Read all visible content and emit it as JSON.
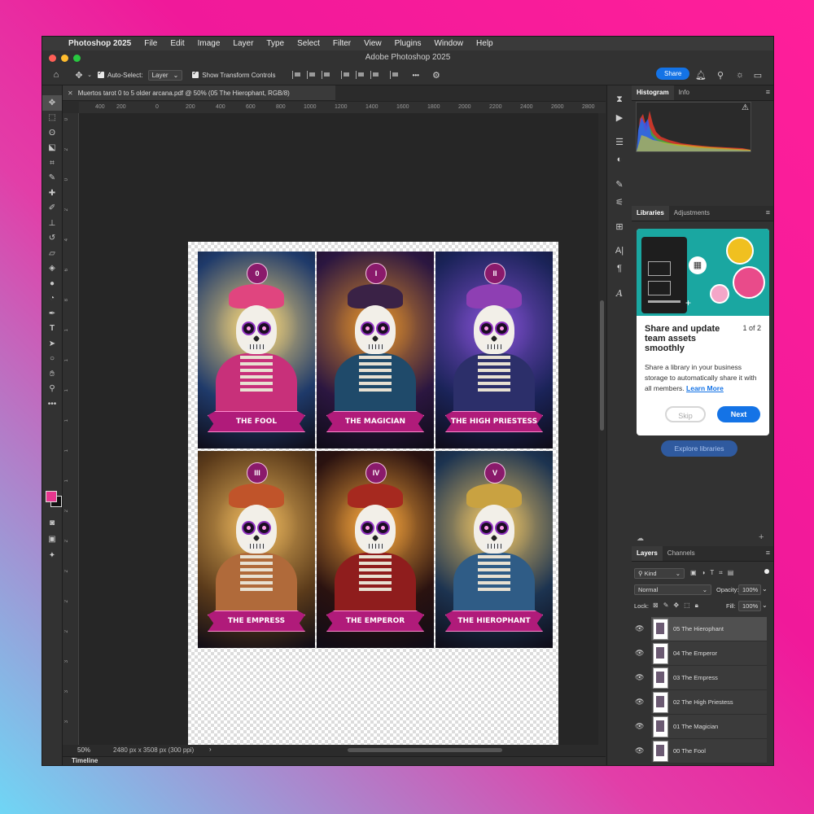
{
  "menubar": {
    "app_name": "Photoshop 2025",
    "items": [
      "File",
      "Edit",
      "Image",
      "Layer",
      "Type",
      "Select",
      "Filter",
      "View",
      "Plugins",
      "Window",
      "Help"
    ]
  },
  "window": {
    "title": "Adobe Photoshop 2025"
  },
  "options_bar": {
    "auto_select_label": "Auto-Select:",
    "auto_select_value": "Layer",
    "show_transform_label": "Show Transform Controls",
    "more": "•••",
    "share_label": "Share"
  },
  "document": {
    "tab_title": "Muertos tarot  0 to 5 older arcana.pdf @ 50% (05 The Hierophant, RGB/8)",
    "zoom": "50%",
    "dimensions": "2480 px x 3508 px (300 ppi)",
    "hruler_labels": [
      "400",
      "200",
      "0",
      "200",
      "400",
      "600",
      "800",
      "1000",
      "1200",
      "1400",
      "1600",
      "1800",
      "2000",
      "2200",
      "2400",
      "2600",
      "2800"
    ],
    "vruler_labels": [
      "0",
      "2",
      "0",
      "2",
      "4",
      "6",
      "8",
      "1",
      "1",
      "1",
      "1",
      "1",
      "1",
      "2",
      "2",
      "2",
      "2",
      "2",
      "3",
      "3",
      "3"
    ],
    "cards": [
      {
        "numeral": "0",
        "title": "THE FOOL",
        "palette": {
          "bg": "#1f3a6a",
          "halo": "#f3d37a",
          "crown": "#e0457f",
          "body": "#c8307a"
        }
      },
      {
        "numeral": "I",
        "title": "THE MAGICIAN",
        "palette": {
          "bg": "#2b1640",
          "halo": "#d88a2c",
          "crown": "#3a2246",
          "body": "#1f4a6a"
        }
      },
      {
        "numeral": "II",
        "title": "THE HIGH PRIESTESS",
        "palette": {
          "bg": "#1a2358",
          "halo": "#7a4cc9",
          "crown": "#8e3fb3",
          "body": "#2c2f6a"
        }
      },
      {
        "numeral": "III",
        "title": "THE EMPRESS",
        "palette": {
          "bg": "#5a3a1a",
          "halo": "#e6b25a",
          "crown": "#c0542a",
          "body": "#b06a3a"
        }
      },
      {
        "numeral": "IV",
        "title": "THE EMPEROR",
        "palette": {
          "bg": "#2a1210",
          "halo": "#f0a03a",
          "crown": "#a6291f",
          "body": "#8f1d1d"
        }
      },
      {
        "numeral": "V",
        "title": "THE HIEROPHANT",
        "palette": {
          "bg": "#1c3350",
          "halo": "#e8c064",
          "crown": "#c9a241",
          "body": "#2f5c86"
        }
      }
    ]
  },
  "timeline_label": "Timeline",
  "panels": {
    "histogram_tabs": [
      "Histogram",
      "Info"
    ],
    "libraries_tabs": [
      "Libraries",
      "Adjustments"
    ],
    "callout": {
      "title": "Share and update team assets smoothly",
      "page": "1 of 2",
      "body": "Share a library in your business storage to automatically share it with all members.",
      "learn_more": "Learn More",
      "skip": "Skip",
      "next": "Next"
    },
    "explore_label": "Explore libraries",
    "layers_tabs": [
      "Layers",
      "Channels"
    ],
    "kind_label": "Kind",
    "blend_mode": "Normal",
    "opacity_label": "Opacity:",
    "opacity_value": "100%",
    "lock_label": "Lock:",
    "fill_label": "Fill:",
    "fill_value": "100%",
    "layers": [
      {
        "name": "05 The Hierophant",
        "selected": true
      },
      {
        "name": "04 The Emperor",
        "selected": false
      },
      {
        "name": "03 The Empress",
        "selected": false
      },
      {
        "name": "02 The High Priestess",
        "selected": false
      },
      {
        "name": "01 The Magician",
        "selected": false
      },
      {
        "name": "00 The Fool",
        "selected": false
      }
    ]
  },
  "colors": {
    "foreground": "#e6378f",
    "background": "#111111",
    "accent": "#1473e6",
    "banner": "#b01b7a"
  },
  "icons": {
    "tools": [
      "move-icon",
      "marquee-icon",
      "lasso-icon",
      "object-select-icon",
      "crop-icon",
      "eyedropper-icon",
      "healing-icon",
      "brush-icon",
      "stamp-icon",
      "history-brush-icon",
      "eraser-icon",
      "paint-bucket-icon",
      "blur-icon",
      "dodge-icon",
      "pen-icon",
      "type-icon",
      "path-select-icon",
      "ellipse-icon",
      "hand-icon",
      "zoom-icon",
      "more-tools-icon"
    ]
  }
}
